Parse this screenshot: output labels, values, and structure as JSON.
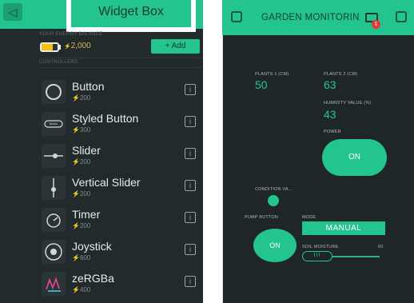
{
  "left_panel": {
    "back_icon": "chevron-left-icon",
    "title": "Widget Box",
    "energy_label": "YOUR ENERGY BALANCE",
    "energy_value": "2,000",
    "add_label": "+ Add",
    "controllers_label": "CONTROLLERS",
    "widgets": [
      {
        "name": "Button",
        "cost": "200",
        "icon": "button-icon"
      },
      {
        "name": "Styled Button",
        "cost": "300",
        "icon": "styled-button-icon"
      },
      {
        "name": "Slider",
        "cost": "200",
        "icon": "slider-icon"
      },
      {
        "name": "Vertical Slider",
        "cost": "200",
        "icon": "vertical-slider-icon"
      },
      {
        "name": "Timer",
        "cost": "200",
        "icon": "timer-icon"
      },
      {
        "name": "Joystick",
        "cost": "600",
        "icon": "joystick-icon"
      },
      {
        "name": "zeRGBa",
        "cost": "400",
        "icon": "zergba-icon"
      }
    ],
    "styled_button_caption": "Button",
    "info_glyph": "i"
  },
  "right_panel": {
    "title": "GARDEN MONITORIN",
    "badge_count": "1",
    "plants1_label": "PLANTS 1 (CM)",
    "plants1_value": "50",
    "plants2_label": "PLANTS 2 (CM)",
    "plants2_value": "63",
    "humidity_label": "HUMIDITY VALUE (%)",
    "humidity_value": "43",
    "power_label": "POWER",
    "power_button": "ON",
    "condition_label": "CONDITION VA...",
    "pump_label": "PUMP BUTTON",
    "pump_button": "ON",
    "mode_label": "MODE",
    "mode_value": "MANUAL",
    "soil_label": "SOIL MOISTURE",
    "soil_value": "60",
    "slider_thumb_glyph": "III"
  },
  "colors": {
    "accent": "#23c48e",
    "left_bg": "#222a2c",
    "right_bg": "#1f2628",
    "energy_battery": "#f4c20d",
    "badge": "#e23b3b"
  }
}
